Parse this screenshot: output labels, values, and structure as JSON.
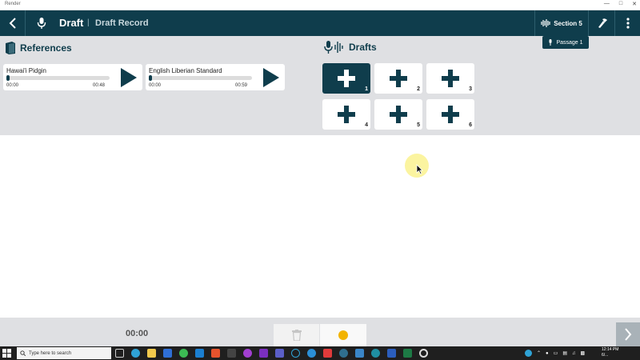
{
  "window": {
    "title": "Render"
  },
  "appbar": {
    "title": "Draft",
    "separator": "|",
    "subtitle": "Draft Record",
    "section_label": "Section 5"
  },
  "tooltip": {
    "passage_label": "Passage 1"
  },
  "references": {
    "heading": "References",
    "items": [
      {
        "name": "Hawai'i Pidgin",
        "start": "00:00",
        "end": "00:48",
        "progress": 0.0
      },
      {
        "name": "English Liberian Standard",
        "start": "00:00",
        "end": "00:59",
        "progress": 0.0
      }
    ]
  },
  "drafts": {
    "heading": "Drafts",
    "slots": [
      {
        "number": "1",
        "active": true
      },
      {
        "number": "2",
        "active": false
      },
      {
        "number": "3",
        "active": false
      },
      {
        "number": "4",
        "active": false
      },
      {
        "number": "5",
        "active": false
      },
      {
        "number": "6",
        "active": false
      }
    ]
  },
  "recorder": {
    "timer": "00:00",
    "record_color": "#f2b300"
  },
  "taskbar": {
    "search_placeholder": "Type here to search",
    "time": "12:14 PM",
    "date": "6/..."
  },
  "colors": {
    "brand": "#0f3d4c",
    "panel": "#dfe0e3"
  }
}
